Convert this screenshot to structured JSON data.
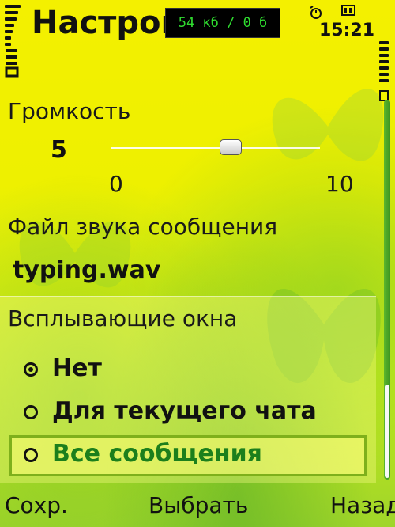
{
  "status": {
    "title": "Настройк",
    "data_counter": "54 кб / 0 б",
    "time": "15:21"
  },
  "volume": {
    "label": "Громкость",
    "value": "5",
    "min": "0",
    "max": "10"
  },
  "sound_file": {
    "label": "Файл звука сообщения",
    "value": "typing.wav"
  },
  "popups": {
    "label": "Всплывающие окна",
    "options": [
      {
        "label": "Нет",
        "checked": true
      },
      {
        "label": "Для текущего чата",
        "checked": false
      },
      {
        "label": "Все сообщения",
        "checked": false
      }
    ]
  },
  "softkeys": {
    "left": "Сохр.",
    "middle": "Выбрать",
    "right": "Назад"
  },
  "colors": {
    "accent": "#1c7f1c",
    "background": "#f4f000",
    "counter_text": "#2fdc2f"
  }
}
